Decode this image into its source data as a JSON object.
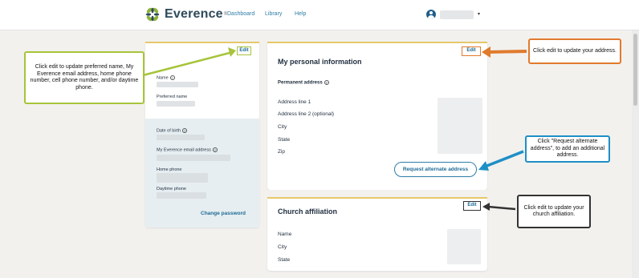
{
  "header": {
    "logo_text": "Everence",
    "logo_mark": "®",
    "nav": [
      "Dashboard",
      "Library",
      "Help"
    ],
    "user_caret": "▾"
  },
  "left_card": {
    "edit_label": "Edit",
    "name_label": "Name",
    "preferred_name_label": "Preferred name",
    "dob_label": "Date of birth",
    "email_label": "My Everence email address",
    "home_phone_label": "Home phone",
    "daytime_phone_label": "Daytime phone",
    "change_password_label": "Change password",
    "help_glyph": "?"
  },
  "info_card": {
    "title": "My personal information",
    "edit_label": "Edit",
    "permanent_address_label": "Permanent address",
    "fields": [
      "Address line 1",
      "Address line 2 (optional)",
      "City",
      "State",
      "Zip"
    ],
    "request_button": "Request alternate address"
  },
  "church_card": {
    "title": "Church affiliation",
    "edit_label": "Edit",
    "fields": [
      "Name",
      "City",
      "State"
    ]
  },
  "callouts": {
    "green": "Click edit to update preferred name, My Everence email address, home phone number, cell phone number, and/or daytime phone.",
    "orange": "Click edit to update your address.",
    "blue": "Click \"Request alternate address\", to add an additional address.",
    "dark": "Click edit to update your church affiliation."
  },
  "colors": {
    "accent_green": "#a7c43b",
    "accent_orange": "#e07b2e",
    "accent_blue": "#1e8fc6",
    "card_top_border": "#e6c86a",
    "link_blue": "#1d6a96"
  }
}
